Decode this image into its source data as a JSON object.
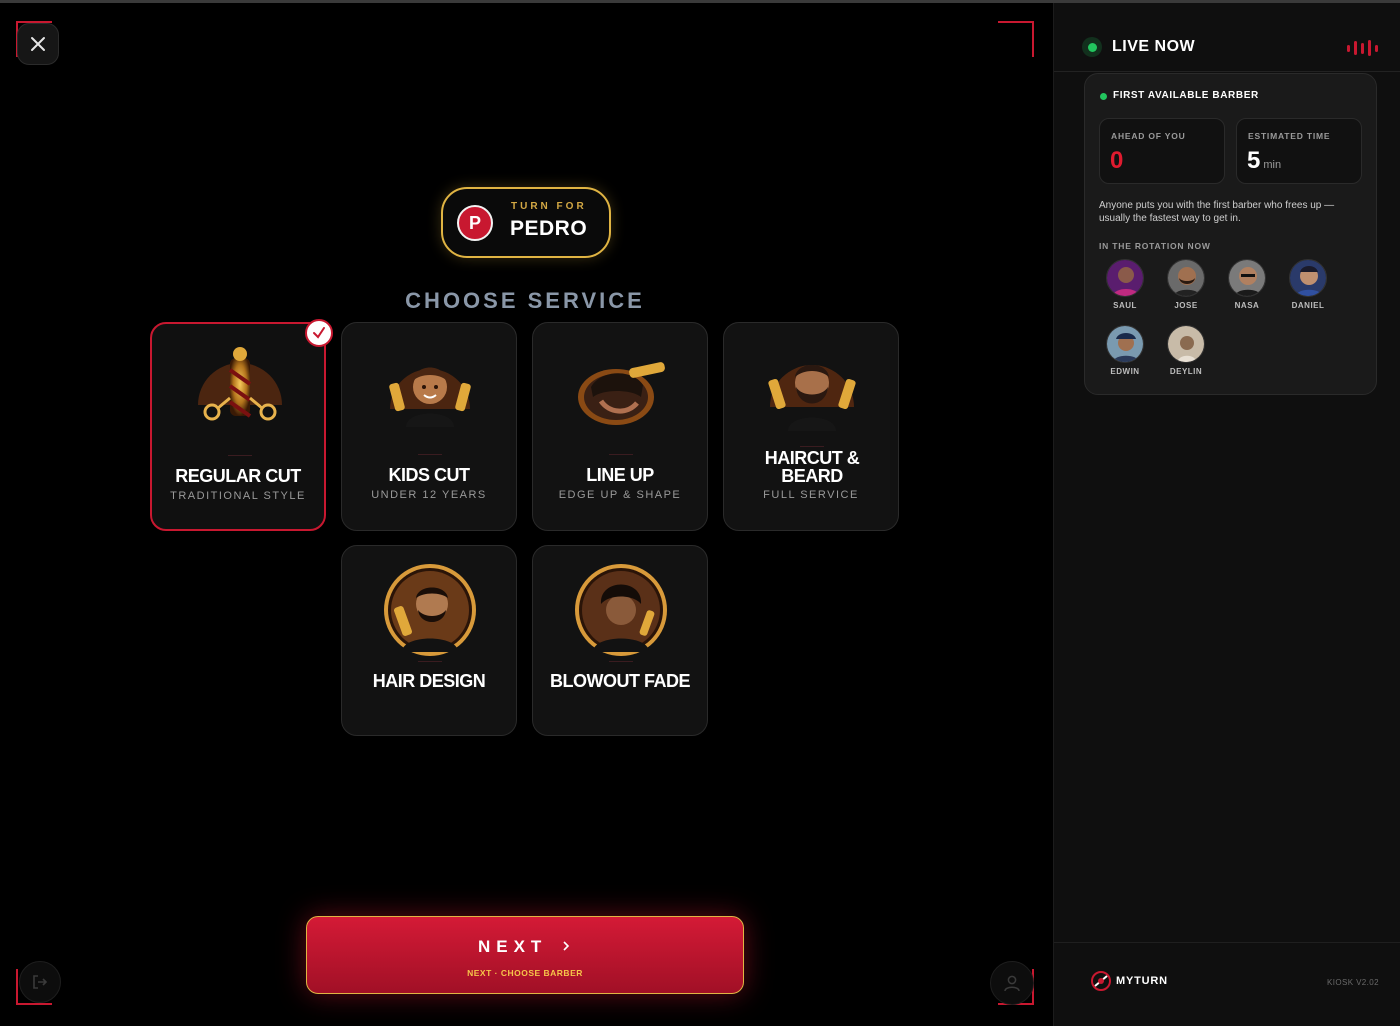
{
  "main": {
    "turn": {
      "label": "TURN FOR",
      "initial": "P",
      "name": "PEDRO"
    },
    "section_title": "CHOOSE SERVICE",
    "services": [
      {
        "title": "REGULAR CUT",
        "subtitle": "TRADITIONAL STYLE",
        "icon": "barber-pole-scissors-icon",
        "selected": true
      },
      {
        "title": "KIDS CUT",
        "subtitle": "UNDER 12 YEARS",
        "icon": "kid-barber-icon",
        "selected": false
      },
      {
        "title": "LINE UP",
        "subtitle": "EDGE UP & SHAPE",
        "icon": "lineup-clipper-icon",
        "selected": false
      },
      {
        "title": "HAIRCUT & BEARD",
        "subtitle": "FULL SERVICE",
        "icon": "bearded-man-icon",
        "selected": false
      },
      {
        "title": "HAIR DESIGN",
        "subtitle": "",
        "icon": "hair-design-icon",
        "selected": false
      },
      {
        "title": "BLOWOUT FADE",
        "subtitle": "",
        "icon": "blowout-fade-icon",
        "selected": false
      }
    ],
    "next": {
      "label": "NEXT",
      "sublabel": "NEXT · CHOOSE BARBER"
    }
  },
  "sidebar": {
    "title": "LIVE NOW",
    "card": {
      "label": "FIRST AVAILABLE BARBER",
      "ahead_label": "AHEAD OF YOU",
      "ahead_value": "0",
      "time_label": "ESTIMATED TIME",
      "time_value": "5",
      "time_unit": "min",
      "description": "Anyone puts you with the first barber who frees up — usually the fastest way to get in.",
      "rotation_label": "IN THE ROTATION NOW",
      "barbers": [
        "SAUL",
        "JOSE",
        "NASA",
        "DANIEL",
        "EDWIN",
        "DEYLIN"
      ]
    },
    "brand": "MYTURN",
    "version": "KIOSK V2.02"
  },
  "colors": {
    "accent": "#c81830",
    "gold": "#e0b443",
    "live": "#22c55e"
  }
}
